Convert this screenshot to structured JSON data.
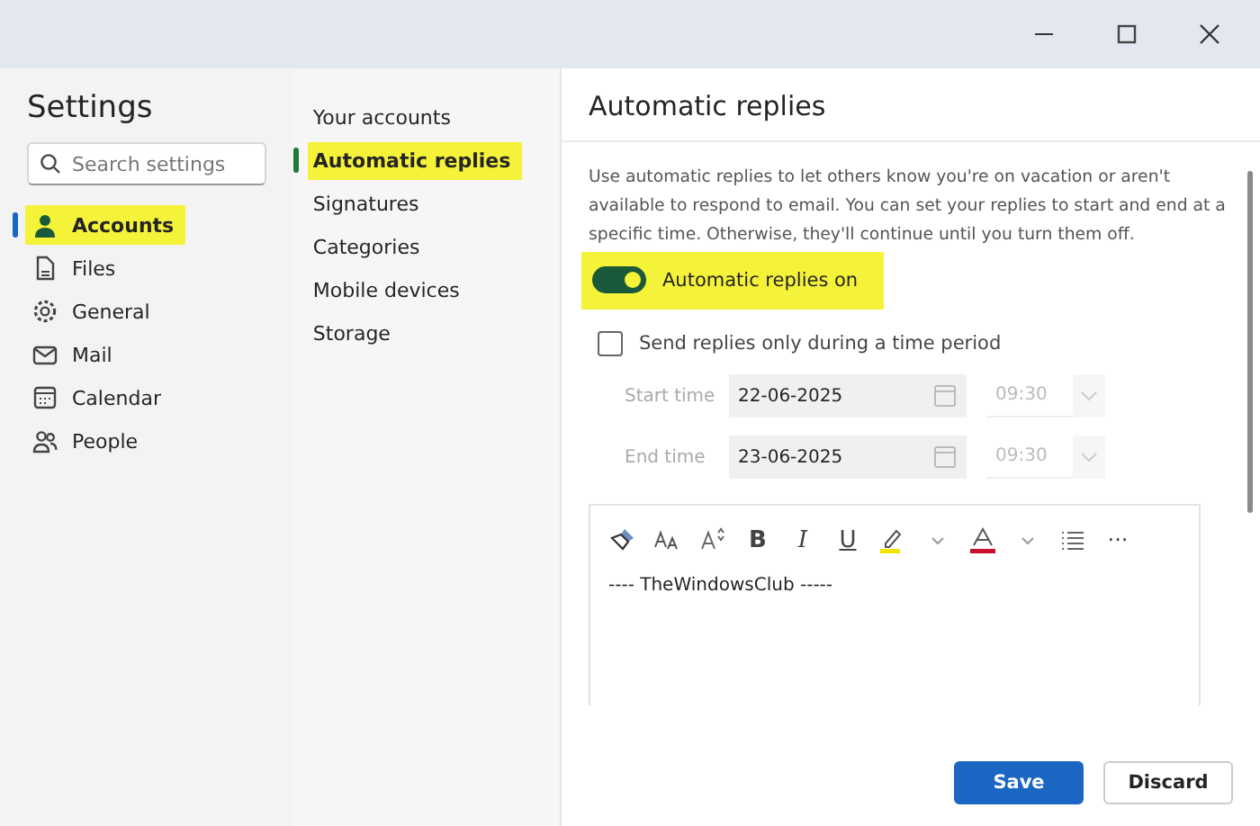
{
  "sidebar": {
    "title": "Settings",
    "search": {
      "placeholder": "Search settings"
    },
    "items": [
      {
        "label": "Accounts",
        "selected": true
      },
      {
        "label": "Files",
        "selected": false
      },
      {
        "label": "General",
        "selected": false
      },
      {
        "label": "Mail",
        "selected": false
      },
      {
        "label": "Calendar",
        "selected": false
      },
      {
        "label": "People",
        "selected": false
      }
    ]
  },
  "subnav": {
    "items": [
      {
        "label": "Your accounts",
        "selected": false
      },
      {
        "label": "Automatic replies",
        "selected": true
      },
      {
        "label": "Signatures",
        "selected": false
      },
      {
        "label": "Categories",
        "selected": false
      },
      {
        "label": "Mobile devices",
        "selected": false
      },
      {
        "label": "Storage",
        "selected": false
      }
    ]
  },
  "panel": {
    "title": "Automatic replies",
    "description": "Use automatic replies to let others know you're on vacation or aren't available to respond to email. You can set your replies to start and end at a specific time. Otherwise, they'll continue until you turn them off.",
    "toggle": {
      "label": "Automatic replies on",
      "on": true
    },
    "period": {
      "label": "Send replies only during a time period",
      "checked": false
    },
    "times": [
      {
        "label": "Start time",
        "date": "22-06-2025",
        "time": "09:30"
      },
      {
        "label": "End time",
        "date": "23-06-2025",
        "time": "09:30"
      }
    ],
    "toolbar": {
      "bold": "B",
      "italic": "I",
      "underline": "U",
      "more": "···"
    },
    "message": "---- TheWindowsClub -----",
    "buttons": {
      "save": "Save",
      "discard": "Discard"
    }
  }
}
